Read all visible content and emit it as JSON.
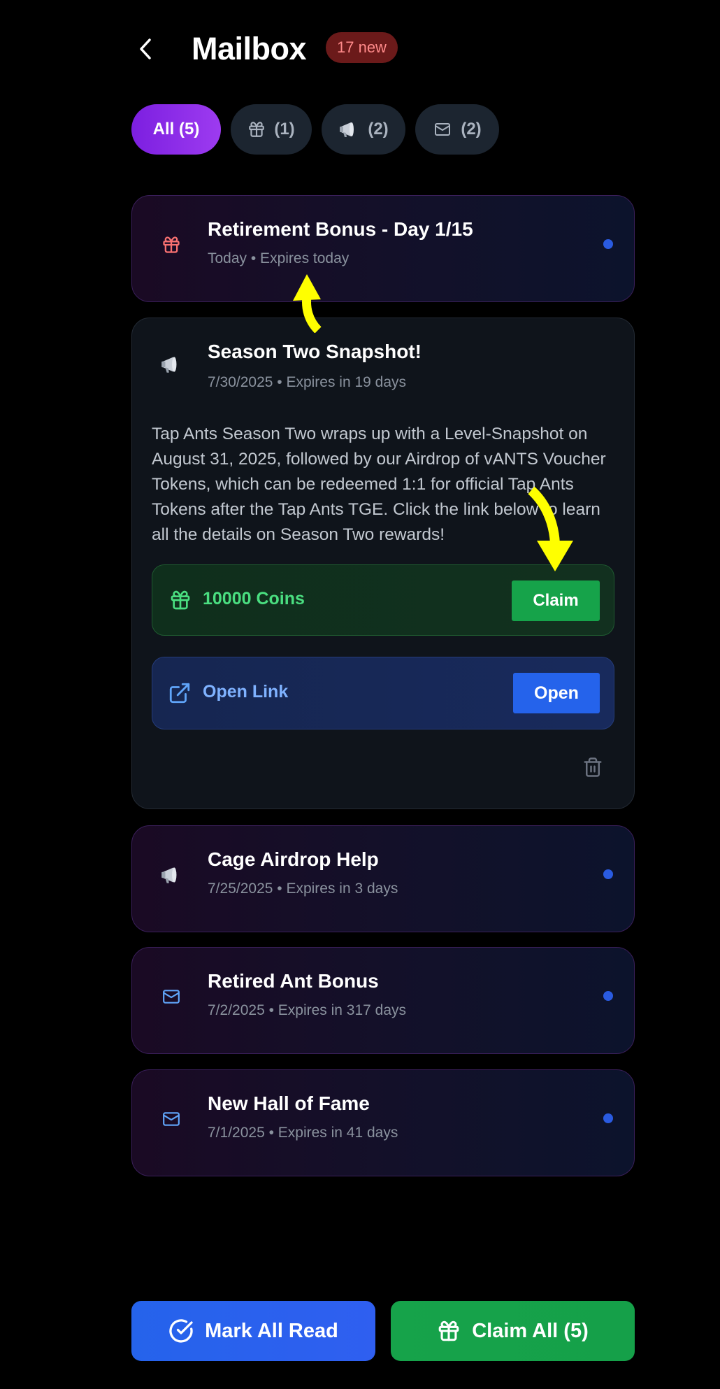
{
  "header": {
    "title": "Mailbox",
    "new_badge": "17 new"
  },
  "filters": [
    {
      "label": "All (5)",
      "icon": "none",
      "active": true
    },
    {
      "label": "(1)",
      "icon": "gift-icon",
      "active": false
    },
    {
      "label": "(2)",
      "icon": "megaphone-icon",
      "active": false
    },
    {
      "label": "(2)",
      "icon": "mail-icon",
      "active": false
    }
  ],
  "messages": [
    {
      "title": "Retirement Bonus - Day 1/15",
      "meta": "Today • Expires today",
      "icon": "gift-icon",
      "unread": true
    },
    {
      "title": "Season Two Snapshot!",
      "meta": "7/30/2025 • Expires in 19 days",
      "icon": "megaphone-icon",
      "expanded": true,
      "body": "Tap Ants Season Two wraps up with a Level-Snapshot on August 31, 2025, followed by our Airdrop of vANTS Voucher Tokens, which can be redeemed 1:1 for official Tap Ants Tokens after the Tap Ants TGE. Click the link below to learn all the details on Season Two rewards!",
      "reward_label": "10000 Coins",
      "claim_label": "Claim",
      "link_label": "Open Link",
      "open_label": "Open"
    },
    {
      "title": "Cage Airdrop Help",
      "meta": "7/25/2025 • Expires in 3 days",
      "icon": "megaphone-icon",
      "unread": true
    },
    {
      "title": "Retired Ant Bonus",
      "meta": "7/2/2025 • Expires in 317 days",
      "icon": "mail-icon",
      "unread": true
    },
    {
      "title": "New Hall of Fame",
      "meta": "7/1/2025 • Expires in 41 days",
      "icon": "mail-icon",
      "unread": true
    }
  ],
  "footer": {
    "mark_all_read": "Mark All Read",
    "claim_all": "Claim All (5)"
  },
  "colors": {
    "active_filter": "#9d3bf0",
    "badge_text": "#ff8a8a",
    "claim_green": "#16a34a",
    "link_blue": "#2563eb",
    "unread_dot": "#2a5be0",
    "annotation_arrow": "#ffff00"
  }
}
